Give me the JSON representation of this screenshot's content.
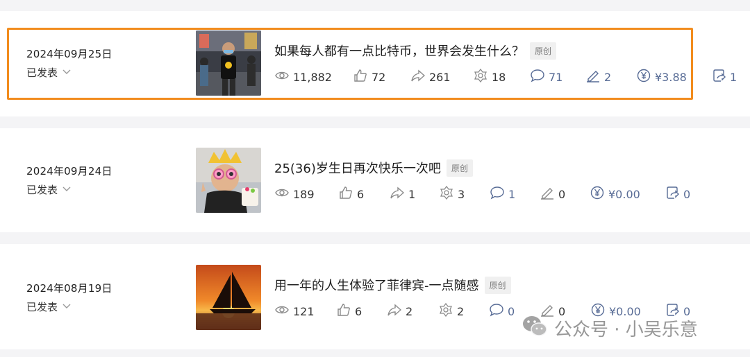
{
  "articles": [
    {
      "date": "2024年09月25日",
      "status": "已发表",
      "title": "如果每人都有一点比特币，世界会发生什么？",
      "tag": "原创",
      "stats": {
        "views": "11,882",
        "likes": "72",
        "shares": "261",
        "wows": "18",
        "comments": "71",
        "notes": "2",
        "rewards": "¥3.88",
        "forwards": "1"
      }
    },
    {
      "date": "2024年09月24日",
      "status": "已发表",
      "title": "25(36)岁生日再次快乐一次吧",
      "tag": "原创",
      "stats": {
        "views": "189",
        "likes": "6",
        "shares": "1",
        "wows": "3",
        "comments": "1",
        "notes": "0",
        "rewards": "¥0.00",
        "forwards": "0"
      }
    },
    {
      "date": "2024年08月19日",
      "status": "已发表",
      "title": "用一年的人生体验了菲律宾-一点随感",
      "tag": "原创",
      "stats": {
        "views": "121",
        "likes": "6",
        "shares": "2",
        "wows": "2",
        "comments": "0",
        "notes": "0",
        "rewards": "¥0.00",
        "forwards": "0"
      }
    }
  ],
  "watermark": {
    "text": "公众号 · 小吴乐意"
  },
  "colors": {
    "highlight": "#f28c1e",
    "link_blue": "#576b95",
    "icon_gray": "#8a8a8a"
  },
  "icons": [
    "eye-icon",
    "thumb-up-icon",
    "share-arrow-icon",
    "flower-icon",
    "comment-icon",
    "pen-icon",
    "yen-icon",
    "forward-icon",
    "chevron-down-icon",
    "wechat-icon"
  ]
}
